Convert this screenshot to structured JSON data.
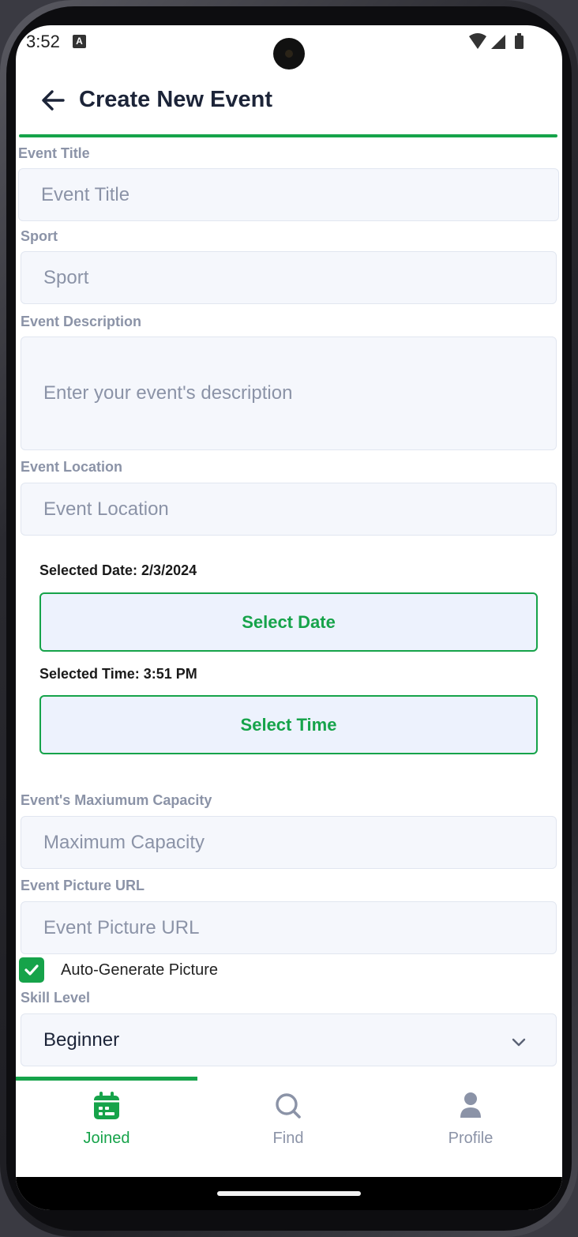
{
  "status_bar": {
    "time": "3:52",
    "notification_glyph": "A"
  },
  "header": {
    "title": "Create New Event"
  },
  "form": {
    "event_title": {
      "label": "Event Title",
      "placeholder": "Event Title"
    },
    "sport": {
      "label": "Sport",
      "placeholder": "Sport"
    },
    "description": {
      "label": "Event Description",
      "placeholder": "Enter your event's description"
    },
    "location": {
      "label": "Event Location",
      "placeholder": "Event Location"
    },
    "date": {
      "selected_text": "Selected Date: 2/3/2024",
      "button_label": "Select Date"
    },
    "time": {
      "selected_text": "Selected Time: 3:51 PM",
      "button_label": "Select Time"
    },
    "capacity": {
      "label": "Event's Maxiumum Capacity",
      "placeholder": "Maximum Capacity"
    },
    "picture_url": {
      "label": "Event Picture URL",
      "placeholder": "Event Picture URL"
    },
    "auto_generate": {
      "label": "Auto-Generate Picture",
      "checked": true
    },
    "skill_level": {
      "label": "Skill Level",
      "value": "Beginner"
    }
  },
  "nav": {
    "items": [
      {
        "label": "Joined",
        "icon": "calendar-icon",
        "active": true
      },
      {
        "label": "Find",
        "icon": "search-icon",
        "active": false
      },
      {
        "label": "Profile",
        "icon": "person-icon",
        "active": false
      }
    ]
  },
  "colors": {
    "accent": "#16a34a",
    "title": "#1c2438",
    "muted": "#8b93a7",
    "input_bg": "#f5f7fc",
    "button_bg": "#edf2fd"
  }
}
